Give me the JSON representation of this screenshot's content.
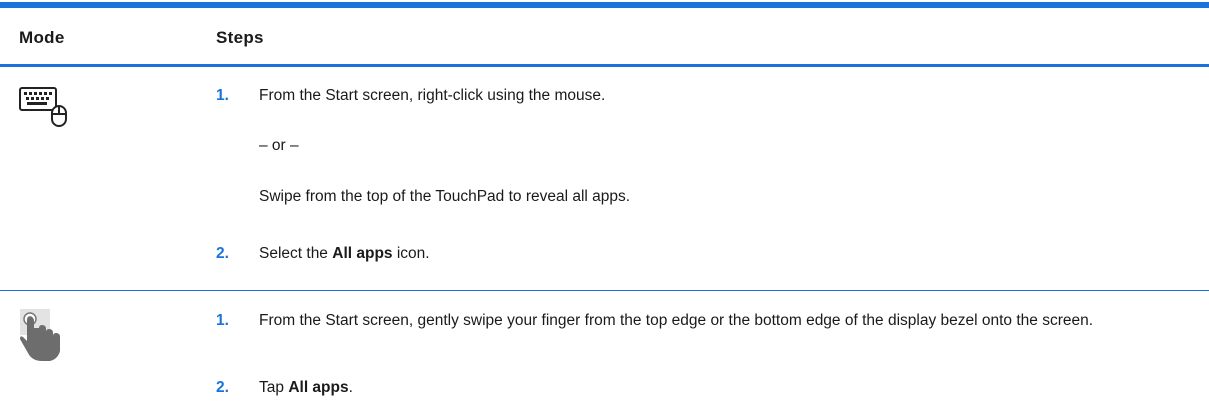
{
  "table": {
    "headers": {
      "mode": "Mode",
      "steps": "Steps"
    },
    "rows": [
      {
        "mode_icon": "keyboard-mouse-icon",
        "steps": [
          {
            "num": "1.",
            "text": "From the Start screen, right-click using the mouse."
          },
          {
            "text": "– or –"
          },
          {
            "text": "Swipe from the top of the TouchPad to reveal all apps."
          },
          {
            "num": "2.",
            "text_before": "Select the ",
            "bold": "All apps",
            "text_after": " icon."
          }
        ]
      },
      {
        "mode_icon": "touch-gesture-icon",
        "steps": [
          {
            "num": "1.",
            "text": "From the Start screen, gently swipe your finger from the top edge or the bottom edge of the display bezel onto the screen."
          },
          {
            "num": "2.",
            "text_before": "Tap ",
            "bold": "All apps",
            "text_after": "."
          }
        ]
      }
    ]
  },
  "colors": {
    "accent": "#1a73d9",
    "text": "#1a1a1a"
  }
}
